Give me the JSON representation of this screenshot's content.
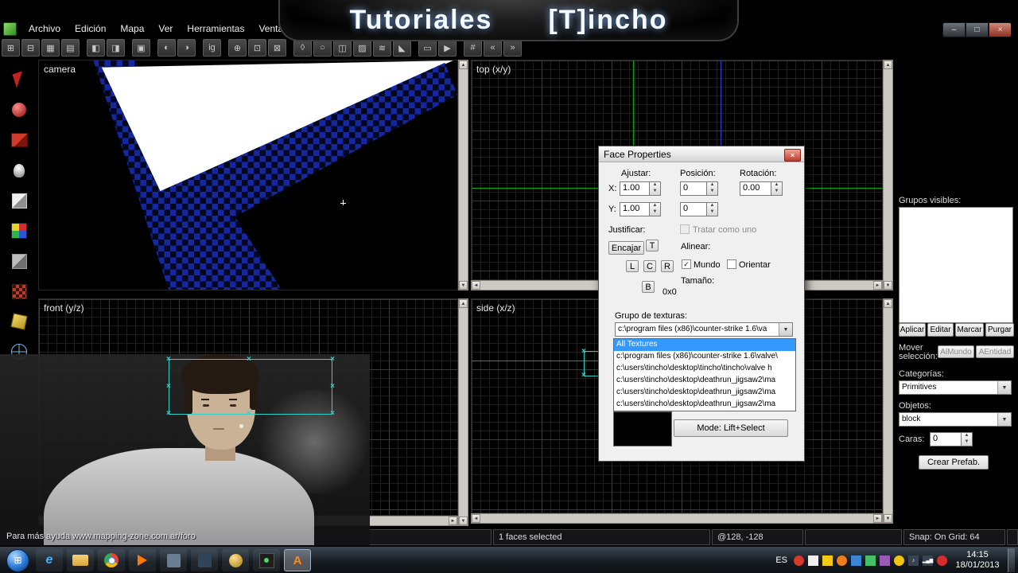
{
  "banner": {
    "title_a": "Tutoriales",
    "title_b": "[T]incho"
  },
  "window": {
    "minimize": "–",
    "maximize": "□",
    "close": "×"
  },
  "menu": {
    "items": [
      "Archivo",
      "Edición",
      "Mapa",
      "Ver",
      "Herramientas",
      "Ventana"
    ]
  },
  "toolbar": {
    "glyphs": [
      "⊞",
      "⊟",
      "▦",
      "▤",
      "◧",
      "◨",
      "▣",
      "◐",
      "◑",
      "ig",
      "⊕",
      "⊡",
      "⊠",
      "◊",
      "○",
      "◫",
      "▨",
      "≋",
      "◣",
      "▭",
      "▶",
      "#",
      "«",
      "»"
    ]
  },
  "palette": {
    "tools": [
      "selection-tool",
      "zoom-tool",
      "camera-tool",
      "entity-tool",
      "block-tool",
      "texture-group-tool",
      "texture-apply-tool",
      "decal-tool",
      "clip-tool",
      "vertex-tool",
      "path-tool"
    ]
  },
  "viewports": {
    "camera": "camera",
    "top": "top (x/y)",
    "front": "front (y/z)",
    "side": "side (x/z)"
  },
  "face_properties": {
    "title": "Face Properties",
    "ajustar": "Ajustar:",
    "posicion": "Posición:",
    "rotacion": "Rotación:",
    "x_label": "X:",
    "y_label": "Y:",
    "scale_x": "1.00",
    "scale_y": "1.00",
    "pos_x": "0",
    "pos_y": "0",
    "rotation": "0.00",
    "justificar": "Justificar:",
    "tratar": "Tratar como uno",
    "encajar": "Encajar",
    "t": "T",
    "l": "L",
    "c": "C",
    "r": "R",
    "b": "B",
    "alinear": "Alinear:",
    "mundo": "Mundo",
    "orientar": "Orientar",
    "tamano": "Tamaño:",
    "tamano_value": "0x0",
    "grupo": "Grupo de texturas:",
    "combo_value": "c:\\program files (x86)\\counter-strike 1.6\\va",
    "items": [
      "All Textures",
      "c:\\program files (x86)\\counter-strike 1.6\\valve\\",
      "c:\\users\\tincho\\desktop\\tincho\\tincho\\valve h",
      "c:\\users\\tincho\\desktop\\deathrun_jigsaw2\\ma",
      "c:\\users\\tincho\\desktop\\deathrun_jigsaw2\\ma",
      "c:\\users\\tincho\\desktop\\deathrun_jigsaw2\\ma"
    ],
    "mode": "Mode: Lift+Select"
  },
  "right_panel": {
    "grupos": "Grupos visibles:",
    "aplicar": "Aplicar",
    "editar": "Editar",
    "marcar": "Marcar",
    "purgar": "Purgar",
    "mover": "Mover selección:",
    "almundo": "AlMundo",
    "aentidad": "AEntidad",
    "categorias": "Categorías:",
    "categorias_value": "Primitives",
    "objetos": "Objetos:",
    "objetos_value": "block",
    "caras": "Caras:",
    "caras_value": "0",
    "crear": "Crear Prefab."
  },
  "status": {
    "help": "Para más ayuda www.mapping-zone.com.ar/foro",
    "selected": "1 faces selected",
    "coords": "@128, -128",
    "snap": "Snap: On Grid: 64"
  },
  "taskbar": {
    "language": "ES",
    "time": "14:15",
    "date": "18/01/2013"
  },
  "icons": {
    "up": "▲",
    "down": "▼",
    "left": "◄",
    "right": "►",
    "combo": "▼",
    "check": "✓"
  }
}
